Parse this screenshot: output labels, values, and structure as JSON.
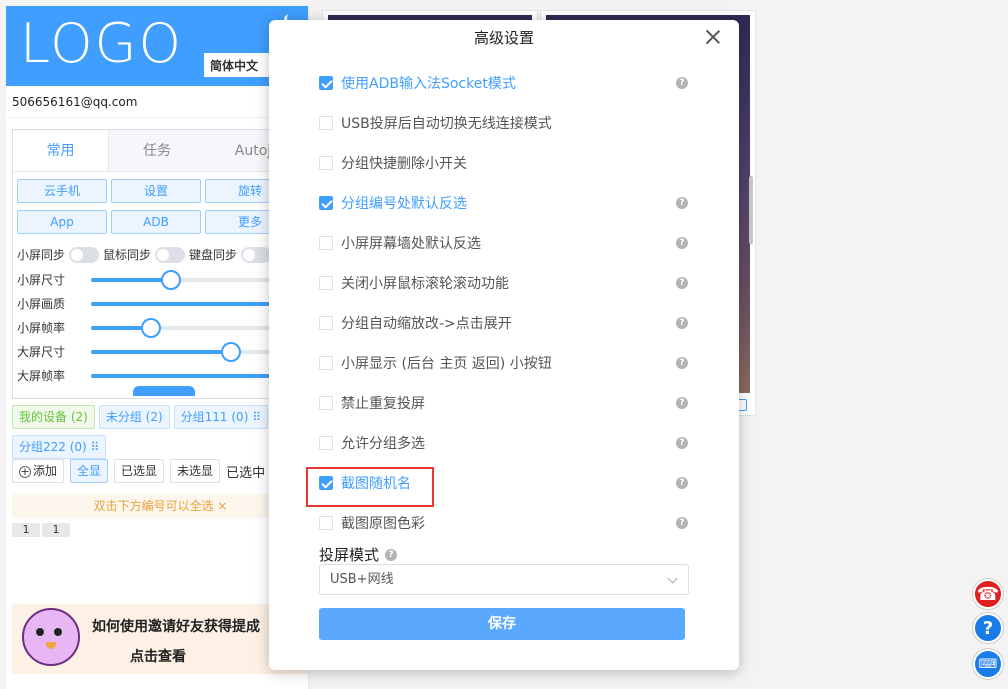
{
  "sidebar": {
    "logo": "LOGO",
    "language": "简体中文",
    "account": "506656161@qq.com",
    "tabs": [
      "常用",
      "任务",
      "Autoj"
    ],
    "buttons": [
      "云手机",
      "设置",
      "旋转",
      "App",
      "ADB",
      "更多"
    ],
    "sync": [
      "小屏同步",
      "鼠标同步",
      "键盘同步"
    ],
    "sliders": [
      {
        "label": "小屏尺寸",
        "value": 0.4
      },
      {
        "label": "小屏画质",
        "value": 1.0
      },
      {
        "label": "小屏帧率",
        "value": 0.3
      },
      {
        "label": "大屏尺寸",
        "value": 0.7
      },
      {
        "label": "大屏帧率",
        "value": 1.0
      }
    ],
    "groups": [
      "我的设备 (2)",
      "未分组 (2)",
      "分组111 (0) ⠿",
      "分组222 (0) ⠿"
    ],
    "actions": {
      "add": "添加",
      "show_all": "全显",
      "show_selected": "已选显",
      "show_unselected": "未选显",
      "selected_count": "已选中"
    },
    "notice": "双击下方编号可以全选 ×",
    "numbers": [
      "1",
      "1"
    ],
    "promo": {
      "title": "如何使用邀请好友获得提成",
      "cta": "点击查看"
    }
  },
  "modal": {
    "title": "高级设置",
    "options": [
      {
        "label": "使用ADB输入法Socket模式",
        "checked": true,
        "help": true
      },
      {
        "label": "USB投屏后自动切换无线连接模式",
        "checked": false,
        "help": false
      },
      {
        "label": "分组快捷删除小开关",
        "checked": false,
        "help": false
      },
      {
        "label": "分组编号处默认反选",
        "checked": true,
        "help": true
      },
      {
        "label": "小屏屏幕墙处默认反选",
        "checked": false,
        "help": true
      },
      {
        "label": "关闭小屏鼠标滚轮滚动功能",
        "checked": false,
        "help": true
      },
      {
        "label": "分组自动缩放改->点击展开",
        "checked": false,
        "help": true
      },
      {
        "label": "小屏显示 (后台 主页 返回) 小按钮",
        "checked": false,
        "help": true
      },
      {
        "label": "禁止重复投屏",
        "checked": false,
        "help": true
      },
      {
        "label": "允许分组多选",
        "checked": false,
        "help": true
      },
      {
        "label": "截图随机名",
        "checked": true,
        "help": true
      },
      {
        "label": "截图原图色彩",
        "checked": false,
        "help": true
      }
    ],
    "mode_label": "投屏模式",
    "mode_value": "USB+网线",
    "save": "保存"
  },
  "colors": {
    "primary": "#409eff",
    "highlight": "#e53935",
    "notice": "#e6a23c",
    "success": "#67c23a"
  },
  "icons": [
    "moon-icon",
    "close-icon",
    "help-icon",
    "chevron-down-icon",
    "plus-circle-icon",
    "expand-icon",
    "customer-service-icon",
    "question-icon",
    "keyboard-icon"
  ]
}
